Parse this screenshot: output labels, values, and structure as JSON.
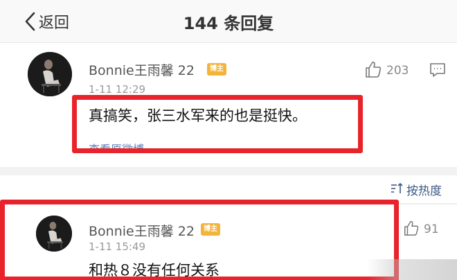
{
  "header": {
    "back_label": "返回",
    "title": "144 条回复"
  },
  "root_comment": {
    "username": "Bonnie王雨馨 22",
    "badge": "博主",
    "timestamp": "1-11 12:29",
    "text": "真搞笑，张三水军来的也是挺快。",
    "view_original": "查看原微博",
    "like_count": "203"
  },
  "sort": {
    "label": "按热度"
  },
  "reply": {
    "username": "Bonnie王雨馨 22",
    "badge": "博主",
    "timestamp": "1-11 15:49",
    "text": "和热８没有任何关系",
    "like_count": "91"
  },
  "colors": {
    "highlight_box": "#e8232b",
    "badge": "#f4b43a",
    "link": "#5b7fb6"
  }
}
